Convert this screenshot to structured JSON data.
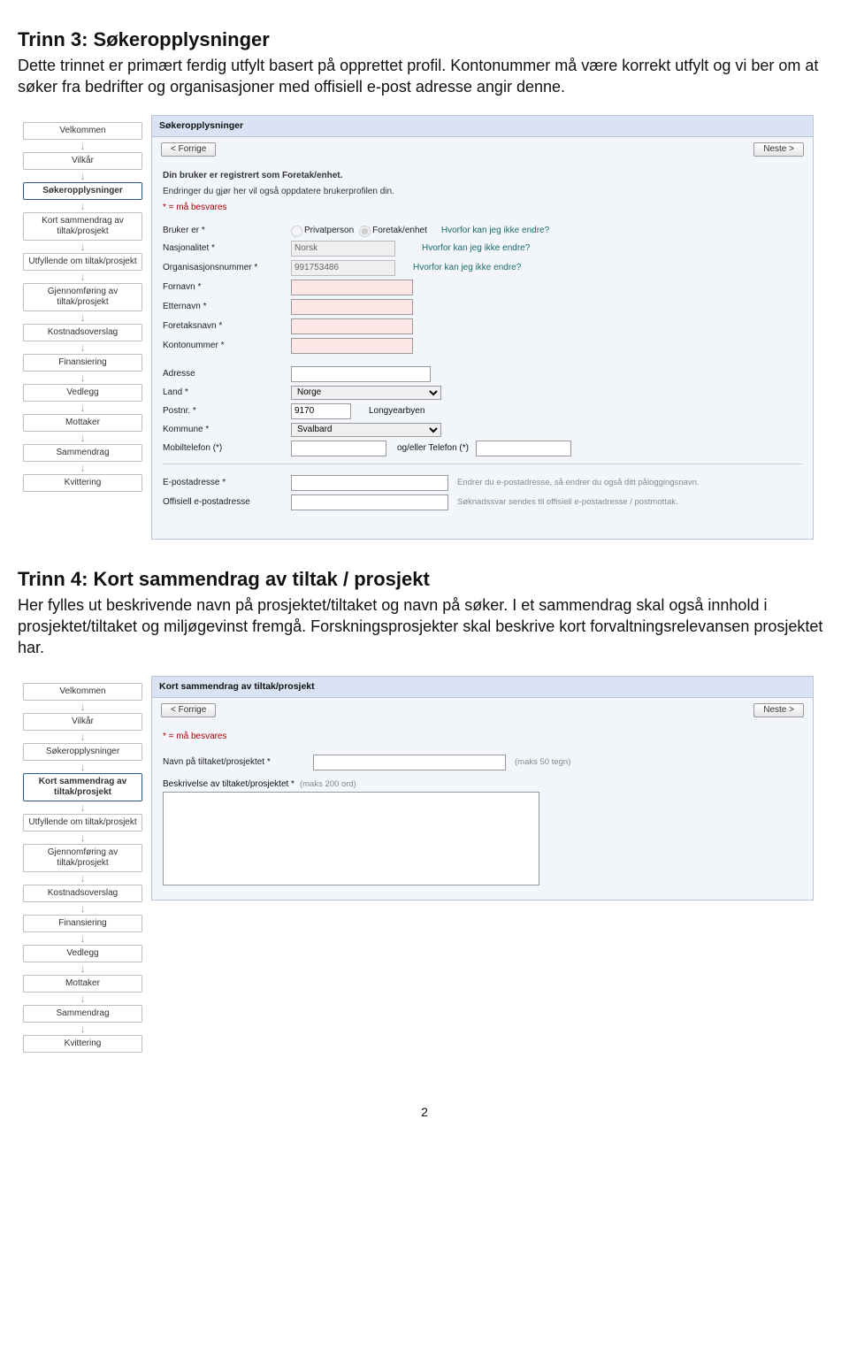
{
  "page_number": "2",
  "section3": {
    "title": "Trinn 3: Søkeropplysninger",
    "intro": "Dette trinnet er primært ferdig utfylt basert på opprettet profil. Kontonummer må være korrekt utfylt og vi ber om at søker fra bedrifter og organisasjoner med offisiell e-post adresse angir denne."
  },
  "section4": {
    "title": "Trinn 4: Kort sammendrag av tiltak / prosjekt",
    "intro": "Her fylles ut beskrivende navn på prosjektet/tiltaket og navn på søker. I et sammendrag skal også innhold i prosjektet/tiltaket og miljøgevinst fremgå. Forskningsprosjekter skal beskrive kort forvaltningsrelevansen prosjektet har."
  },
  "common": {
    "nav": {
      "prev": "< Forrige",
      "next": "Neste >"
    },
    "steps": [
      "Velkommen",
      "Vilkår",
      "Søkeropplysninger",
      "Kort sammendrag av tiltak/prosjekt",
      "Utfyllende om tiltak/prosjekt",
      "Gjennomføring av tiltak/prosjekt",
      "Kostnadsoverslag",
      "Finansiering",
      "Vedlegg",
      "Mottaker",
      "Sammendrag",
      "Kvittering"
    ]
  },
  "shot1": {
    "active_step_index": 2,
    "panel_title": "Søkeropplysninger",
    "reg_line1": "Din bruker er registrert som Foretak/enhet.",
    "reg_line2": "Endringer du gjør her vil også oppdatere brukerprofilen din.",
    "must_answer": "* = må besvares",
    "labels": {
      "bruker": "Bruker er *",
      "nasjonalitet": "Nasjonalitet *",
      "orgnr": "Organisasjonsnummer *",
      "fornavn": "Fornavn *",
      "etternavn": "Etternavn *",
      "foretak": "Foretaksnavn *",
      "konto": "Kontonummer *",
      "adresse": "Adresse",
      "land": "Land *",
      "postnr": "Postnr. *",
      "kommune": "Kommune *",
      "mobil": "Mobiltelefon (*)",
      "ogeller": "og/eller Telefon (*)",
      "epost": "E-postadresse *",
      "offepost": "Offisiell e-postadresse"
    },
    "values": {
      "nasjonalitet": "Norsk",
      "orgnr": "991753486",
      "land": "Norge",
      "postnr": "9170",
      "poststed": "Longyearbyen",
      "kommune": "Svalbard"
    },
    "radios": {
      "privat": "Privatperson",
      "foretak": "Foretak/enhet"
    },
    "change_link": "Hvorfor kan jeg ikke endre?",
    "epost_note": "Endrer du e-postadresse, så endrer du også ditt påloggingsnavn.",
    "offepost_note": "Søknadssvar sendes til offisiell e-postadresse / postmottak."
  },
  "shot2": {
    "active_step_index": 3,
    "panel_title": "Kort sammendrag av tiltak/prosjekt",
    "must_answer": "* = må besvares",
    "labels": {
      "navn": "Navn på tiltaket/prosjektet *",
      "beskrivelse": "Beskrivelse av tiltaket/prosjektet *"
    },
    "hints": {
      "maks50": "(maks 50 tegn)",
      "maks200": "(maks 200 ord)"
    }
  }
}
